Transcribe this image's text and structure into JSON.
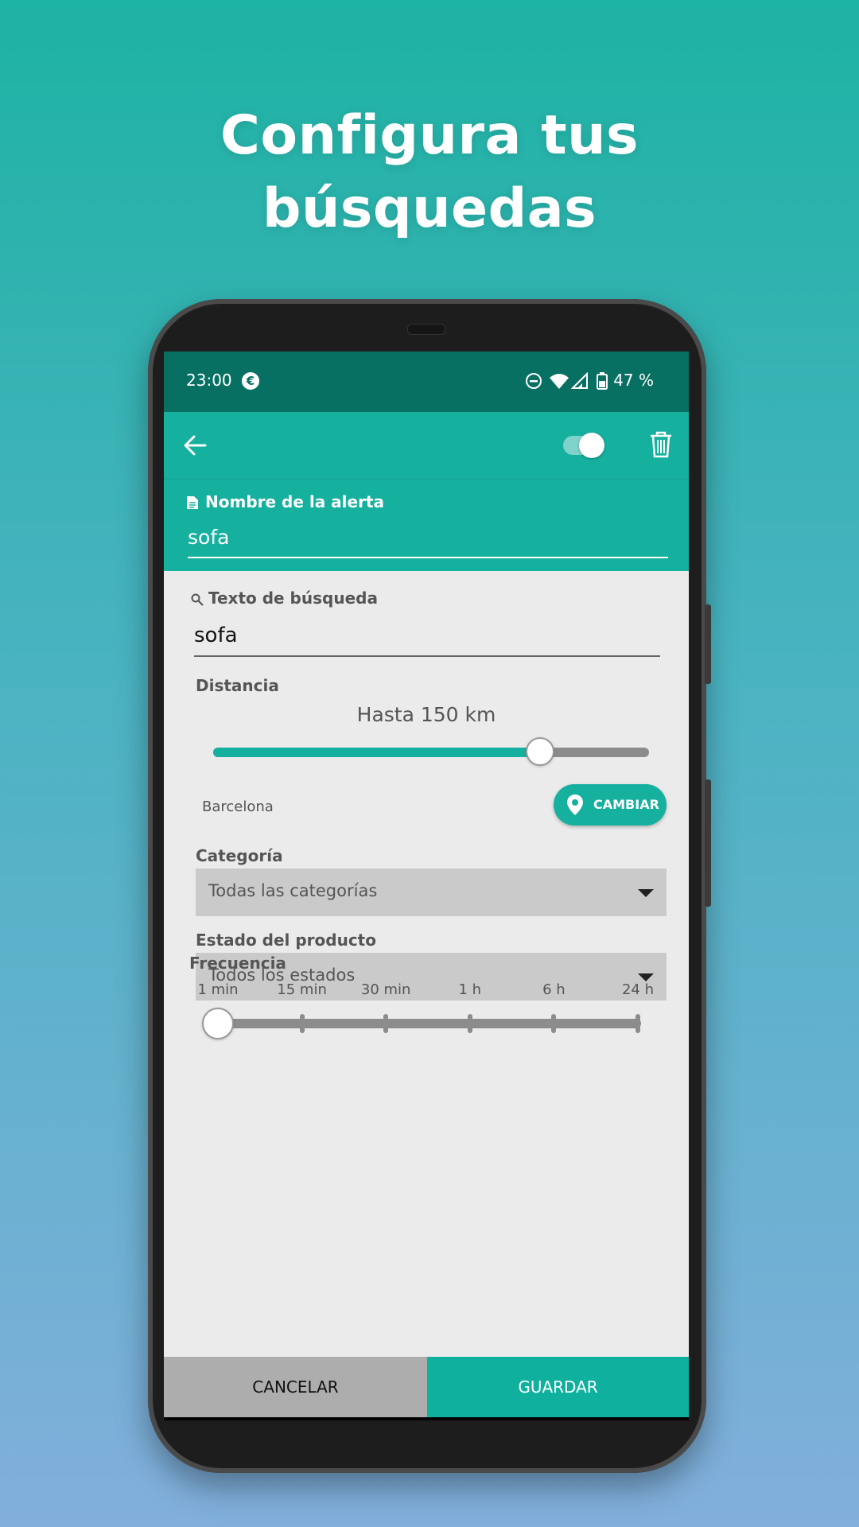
{
  "promo": {
    "headline_line1": "Configura tus",
    "headline_line2": "búsquedas"
  },
  "colors": {
    "accent": "#16b09f",
    "status_bar": "#087062",
    "content_bg": "#ebebeb",
    "cancel_bg": "#adadad"
  },
  "status_bar": {
    "time": "23:00",
    "currency_badge": "€",
    "battery": "47 %",
    "icons": [
      "dnd-icon",
      "wifi-icon",
      "signal-icon",
      "battery-icon"
    ]
  },
  "app_bar": {
    "back_icon": "arrow-left-icon",
    "alert_enabled": true,
    "delete_icon": "trash-icon"
  },
  "alert_name": {
    "label": "Nombre de la alerta",
    "value": "sofa",
    "icon": "document-icon"
  },
  "search_text": {
    "label": "Texto de búsqueda",
    "value": "sofa",
    "icon": "search-icon"
  },
  "distance": {
    "label": "Distancia",
    "value_text": "Hasta 150 km",
    "slider_fraction": 0.75
  },
  "location": {
    "city": "Barcelona",
    "change_button": "CAMBIAR",
    "icon": "location-pin-icon"
  },
  "category": {
    "label": "Categoría",
    "selected": "Todas las categorías"
  },
  "product_state": {
    "label": "Estado del producto",
    "selected": "Todos los estados"
  },
  "frequency": {
    "label": "Frecuencia",
    "options": [
      "1 min",
      "15 min",
      "30 min",
      "1 h",
      "6 h",
      "24 h"
    ],
    "selected_index": 0
  },
  "actions": {
    "cancel": "CANCELAR",
    "save": "GUARDAR"
  }
}
